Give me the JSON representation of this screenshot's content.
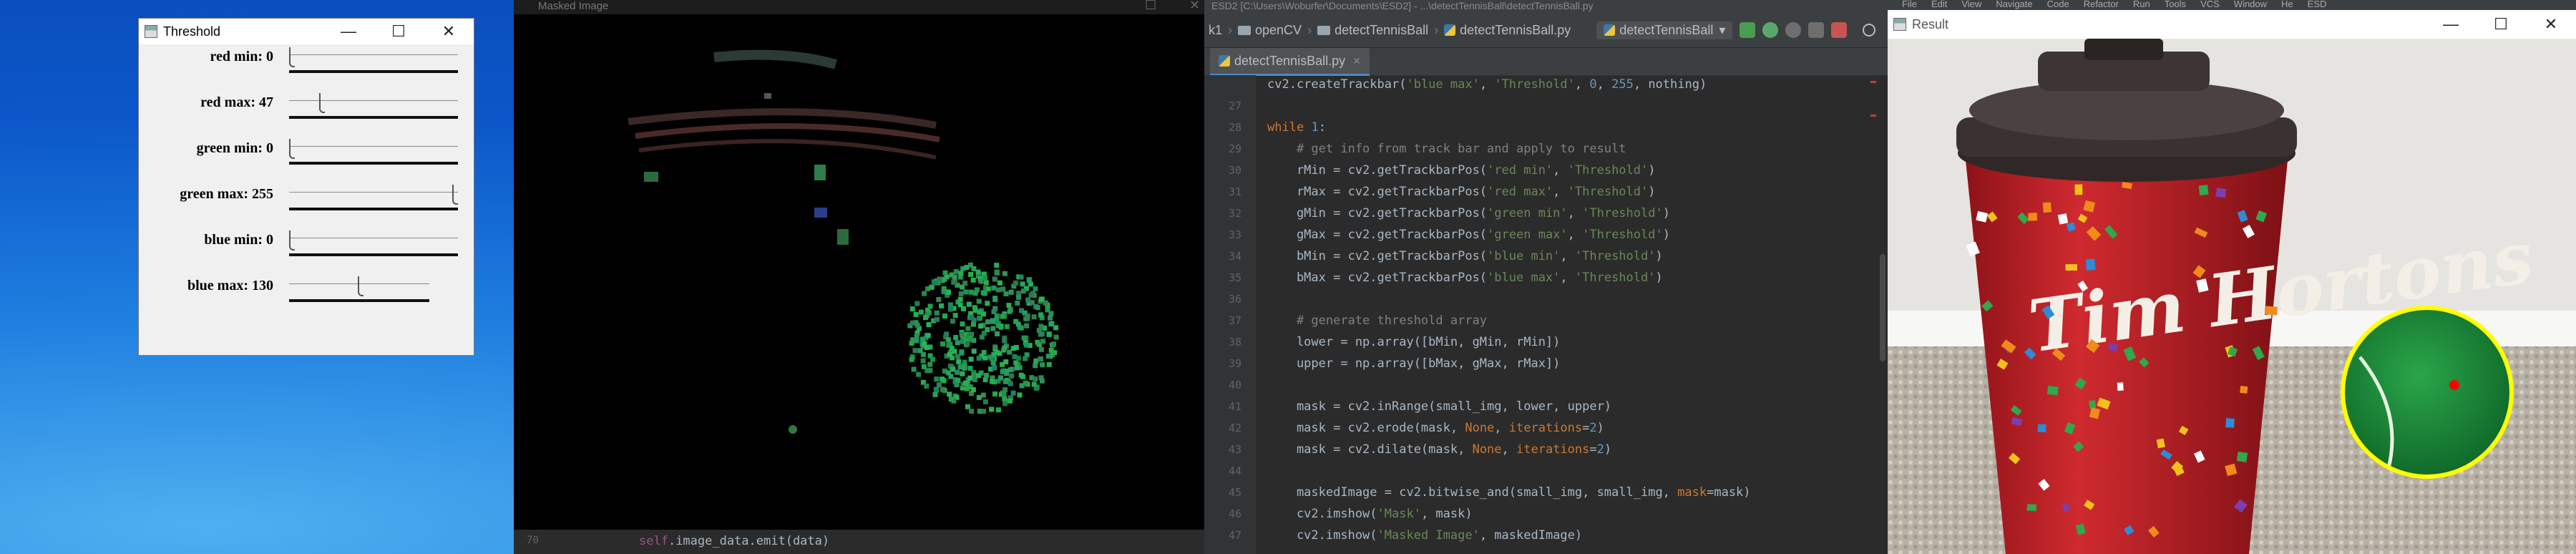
{
  "threshold_window": {
    "title": "Threshold",
    "controls": {
      "minimize": "—",
      "maximize": "☐",
      "close": "✕"
    },
    "trackbars": [
      {
        "label": "red min: 0",
        "fraction": 0.0
      },
      {
        "label": "red max: 47",
        "fraction": 0.184
      },
      {
        "label": "green min: 0",
        "fraction": 0.0
      },
      {
        "label": "green max: 255",
        "fraction": 1.0
      },
      {
        "label": "blue min: 0",
        "fraction": 0.0
      },
      {
        "label": "blue max: 130",
        "fraction": 0.51
      }
    ]
  },
  "masked_window": {
    "title": "Masked Image",
    "status_line_number": "70",
    "status_code": {
      "self": "self",
      "rest": ".image_data.emit(data)"
    }
  },
  "ide": {
    "title": "ESD2 [C:\\Users\\Woburfer\\Documents\\ESD2] - ...\\detectTennisBall\\detectTennisBall.py",
    "breadcrumbs": [
      "k1",
      "openCV",
      "detectTennisBall",
      "detectTennisBall.py"
    ],
    "run_config": "detectTennisBall",
    "tab": "detectTennisBall.py",
    "code_lines": [
      {
        "num": "",
        "text": "cv2.createTrackbar('blue max', 'Threshold', 0, 255, nothing)"
      },
      {
        "num": "27",
        "text": ""
      },
      {
        "num": "28",
        "text": "while 1:"
      },
      {
        "num": "29",
        "text": "    # get info from track bar and apply to result"
      },
      {
        "num": "30",
        "text": "    rMin = cv2.getTrackbarPos('red min', 'Threshold')"
      },
      {
        "num": "31",
        "text": "    rMax = cv2.getTrackbarPos('red max', 'Threshold')"
      },
      {
        "num": "32",
        "text": "    gMin = cv2.getTrackbarPos('green min', 'Threshold')"
      },
      {
        "num": "33",
        "text": "    gMax = cv2.getTrackbarPos('green max', 'Threshold')"
      },
      {
        "num": "34",
        "text": "    bMin = cv2.getTrackbarPos('blue min', 'Threshold')"
      },
      {
        "num": "35",
        "text": "    bMax = cv2.getTrackbarPos('blue max', 'Threshold')"
      },
      {
        "num": "36",
        "text": ""
      },
      {
        "num": "37",
        "text": "    # generate threshold array"
      },
      {
        "num": "38",
        "text": "    lower = np.array([bMin, gMin, rMin])"
      },
      {
        "num": "39",
        "text": "    upper = np.array([bMax, gMax, rMax])"
      },
      {
        "num": "40",
        "text": ""
      },
      {
        "num": "41",
        "text": "    mask = cv2.inRange(small_img, lower, upper)"
      },
      {
        "num": "42",
        "text": "    mask = cv2.erode(mask, None, iterations=2)"
      },
      {
        "num": "43",
        "text": "    mask = cv2.dilate(mask, None, iterations=2)"
      },
      {
        "num": "44",
        "text": ""
      },
      {
        "num": "45",
        "text": "    maskedImage = cv2.bitwise_and(small_img, small_img, mask=mask)"
      },
      {
        "num": "46",
        "text": "    cv2.imshow('Mask', mask)"
      },
      {
        "num": "47",
        "text": "    cv2.imshow('Masked Image', maskedImage)"
      }
    ]
  },
  "result_window": {
    "title": "Result",
    "menu": [
      "File",
      "Edit",
      "View",
      "Navigate",
      "Code",
      "Refactor",
      "Run",
      "Tools",
      "VCS",
      "Window",
      "He",
      "ESD"
    ],
    "cup_text": "Tim Hortons"
  },
  "colors": {
    "ide_bg": "#2b2b2b",
    "keyword": "#cc7832",
    "string": "#6a8759",
    "comment": "#808080",
    "number": "#6897bb",
    "ball": "#1e8c3a",
    "circle": "#ffff00",
    "center_dot": "#ff0000",
    "cup_red": "#c21f28"
  }
}
